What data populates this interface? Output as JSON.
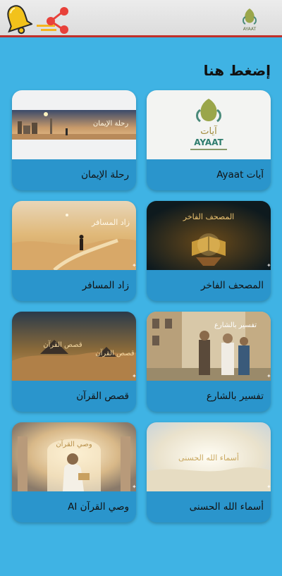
{
  "header": {
    "icons": [
      "bell-icon",
      "share-icon",
      "ayaat-logo"
    ],
    "logo_text": "AYAAT",
    "accent": "#c0302a"
  },
  "main": {
    "heading": "إضغط هنا",
    "background": "#3fb3e4",
    "cards": [
      {
        "label": "آيات Ayaat",
        "thumb_text": "آيات",
        "thumb_sub": "AYAAT"
      },
      {
        "label": "رحلة الإيمان",
        "thumb_text": "رحلة الإيمان"
      },
      {
        "label": "المصحف الفاخر",
        "thumb_text": "المصحف الفاخر"
      },
      {
        "label": "زاد المسافر",
        "thumb_text": "زاد المسافر"
      },
      {
        "label": "تفسير بالشارع",
        "thumb_text": "تفسير بالشارع"
      },
      {
        "label": "قصص القرآن",
        "thumb_text": "قصص القرآن"
      },
      {
        "label": "أسماء الله الحسنى",
        "thumb_text": "أسماء الله الحسنى"
      },
      {
        "label": "وصي القرآن AI",
        "thumb_text": "وصي القرآن"
      }
    ]
  }
}
